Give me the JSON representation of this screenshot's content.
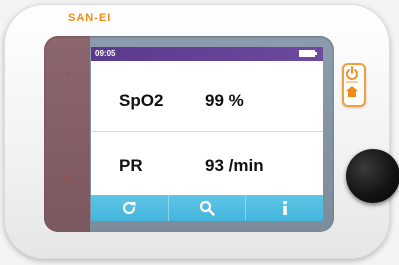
{
  "brand": {
    "name": "SAN-EI"
  },
  "status": {
    "time": "09:05",
    "battery_icon": "battery-full-icon"
  },
  "readings": [
    {
      "label": "SpO2",
      "value": "99 %"
    },
    {
      "label": "PR",
      "value": "93 /min"
    }
  ],
  "toolbar": [
    {
      "icon": "refresh-icon"
    },
    {
      "icon": "search-icon"
    },
    {
      "icon": "info-icon"
    }
  ],
  "hardware": {
    "home_button_icon": "power-home-icon",
    "knob": "round-dial"
  },
  "colors": {
    "brand": "#f28a1a",
    "statusbar": "#5b3a8e",
    "toolbar": "#45b4dc",
    "reading_text": "#111111"
  }
}
